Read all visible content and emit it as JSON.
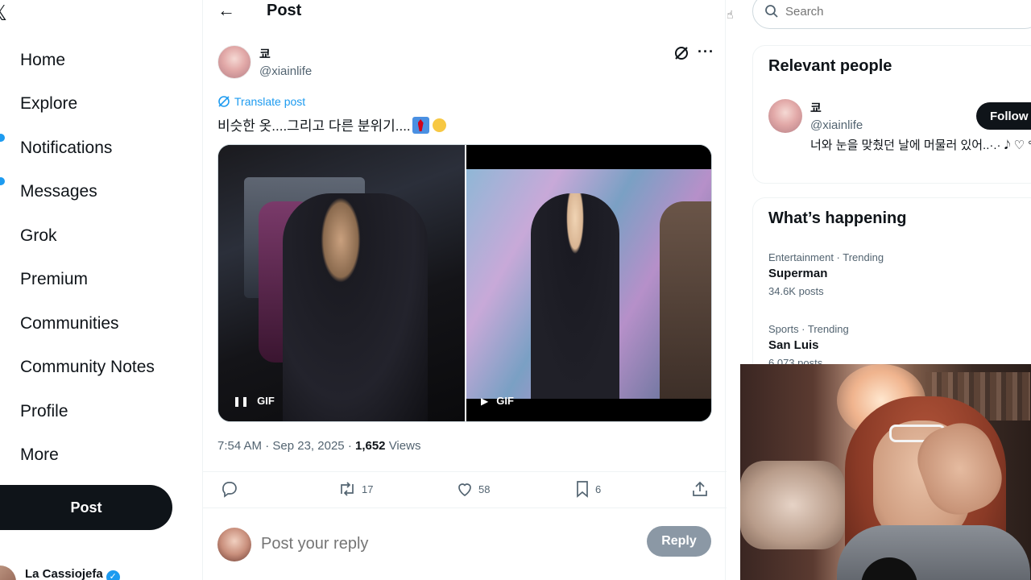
{
  "nav": {
    "items": [
      {
        "label": "Home",
        "icon": "home-icon"
      },
      {
        "label": "Explore",
        "icon": "search-icon"
      },
      {
        "label": "Notifications",
        "icon": "bell-icon",
        "badge": true
      },
      {
        "label": "Messages",
        "icon": "mail-icon",
        "badge": true
      },
      {
        "label": "Grok",
        "icon": "grok-icon"
      },
      {
        "label": "Premium",
        "icon": "x-premium-icon"
      },
      {
        "label": "Communities",
        "icon": "communities-icon"
      },
      {
        "label": "Community Notes",
        "icon": "community-notes-icon"
      },
      {
        "label": "Profile",
        "icon": "person-icon"
      },
      {
        "label": "More",
        "icon": "more-circle-icon"
      }
    ],
    "post_button": "Post",
    "account_name": "La Cassiojefa"
  },
  "header": {
    "title": "Post"
  },
  "post": {
    "author_name": "쿄",
    "author_handle": "@xiainlife",
    "translate_label": "Translate post",
    "text": "비슷한 옷....그리고 다른 분위기....",
    "emojis": [
      "necktie-emoji",
      "chick-emoji"
    ],
    "media": [
      {
        "badge": "GIF",
        "state": "paused",
        "control_icon": "pause-icon"
      },
      {
        "badge": "GIF",
        "state": "playing",
        "control_icon": "play-icon"
      }
    ],
    "time": "7:54 AM",
    "date": "Sep 23, 2025",
    "views_count": "1,652",
    "views_label": "Views",
    "separator": "·",
    "actions": {
      "reply_count": "",
      "repost_count": "17",
      "like_count": "58",
      "bookmark_count": "6"
    }
  },
  "reply": {
    "placeholder": "Post your reply",
    "button": "Reply"
  },
  "sidebar": {
    "search_placeholder": "Search",
    "relevant_people": {
      "title": "Relevant people",
      "name": "쿄",
      "handle": "@xiainlife",
      "bio": "너와 눈을 맞췄던 날에 머물러 있어..·.· 𝅘𝅥𝅮 ♡ °*",
      "follow_label": "Follow"
    },
    "whats_happening": {
      "title": "What’s happening",
      "trends": [
        {
          "meta": "Entertainment · Trending",
          "name": "Superman",
          "count": "34.6K posts"
        },
        {
          "meta": "Sports · Trending",
          "name": "San Luis",
          "count": "6,073 posts"
        }
      ]
    }
  },
  "colors": {
    "accent": "#1d9bf0",
    "text": "#0f1419",
    "secondary": "#536471",
    "button_dark": "#0f1419",
    "reply_button_disabled": "#8b98a5"
  }
}
